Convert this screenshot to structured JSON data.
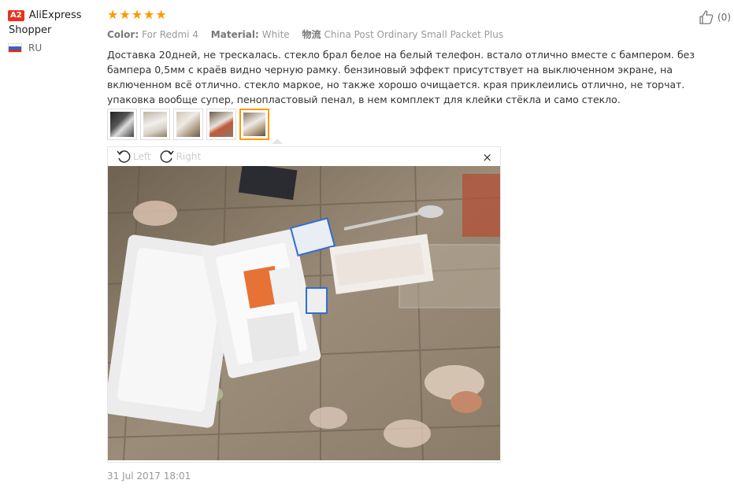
{
  "user": {
    "badge": "A2",
    "name_line1": "AliExpress",
    "name_line2": "Shopper",
    "country": "RU"
  },
  "rating": {
    "stars": 5,
    "max": 5
  },
  "attributes": [
    {
      "label": "Color:",
      "value": "For Redmi 4"
    },
    {
      "label": "Material:",
      "value": "White"
    },
    {
      "label": "物流",
      "value": "China Post Ordinary Small Packet Plus"
    }
  ],
  "review_text": "Доставка 20дней, не трескалась. стекло брал белое на белый телефон. встало отлично вместе с бампером. без бампера 0,5мм с краёв видно черную рамку. бензиновый эффект присутствует на выключенном экране, на включенном всё отлично. стекло маркое, но также хорошо очищается. края приклеились отлично, не торчат. упаковка вообще супер, пенопластовый пенал, в нем комплект для клейки стёкла и само стекло.",
  "like": {
    "count": "(0)"
  },
  "viewer": {
    "left_label": "Left",
    "right_label": "Right",
    "close_label": "×"
  },
  "date": "31 Jul 2017 18:01",
  "colors": {
    "accent_orange": "#ff9900",
    "badge_red": "#e6331e"
  }
}
